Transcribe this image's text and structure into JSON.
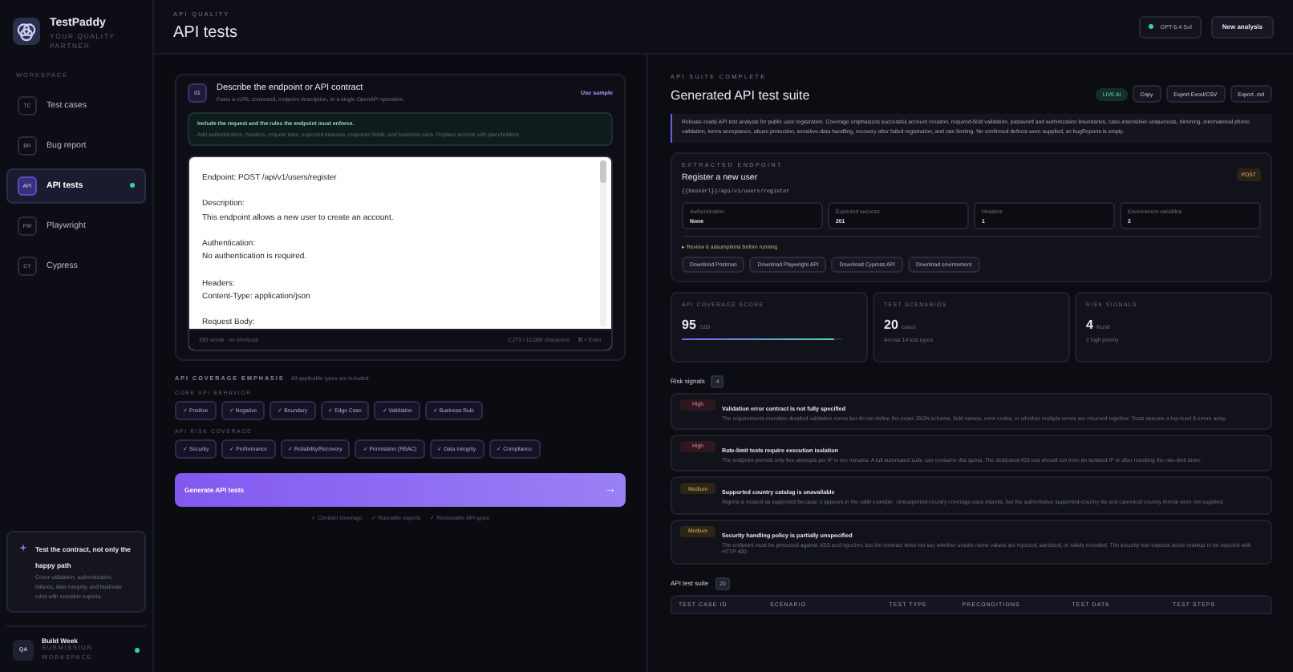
{
  "sidebar": {
    "brand": "TestPaddy",
    "tagline": "YOUR QUALITY PARTNER",
    "section": "WORKSPACE",
    "items": [
      {
        "badge": "TC",
        "label": "Test cases",
        "selected": false
      },
      {
        "badge": "BR",
        "label": "Bug report",
        "selected": false
      },
      {
        "badge": "API",
        "label": "API tests",
        "selected": true
      },
      {
        "badge": "PW",
        "label": "Playwright",
        "selected": false
      },
      {
        "badge": "CY",
        "label": "Cypress",
        "selected": false
      }
    ],
    "tip": {
      "title": "Test the contract, not only the happy path",
      "body": "Cover validation, authentication, failures, data integrity, and business rules with runnable exports."
    },
    "workspace": {
      "avatar": "QA",
      "name": "Build Week",
      "role": "SUBMISSION WORKSPACE",
      "online": true
    }
  },
  "header": {
    "eyebrow": "API QUALITY",
    "title": "API tests",
    "model": "GPT-5.4 Sol",
    "model_online": true,
    "button": "New analysis"
  },
  "input": {
    "step": "01",
    "heading": "Describe the endpoint or API contract",
    "subheading": "Paste a cURL command, endpoint description, or a single OpenAPI operation.",
    "sample_link": "Use sample",
    "hint_title": "Include the request and the rules the endpoint must enforce.",
    "hint_body": "Add authentication, headers, request data, expected statuses, response fields, and business rules. Replace secrets with placeholders.",
    "value": "Endpoint: POST /api/v1/users/register\n\nDescription:\nThis endpoint allows a new user to create an account.\n\nAuthentication:\nNo authentication is required.\n\nHeaders:\nContent-Type: application/json\n\nRequest Body:",
    "word_count": "330 words · no shortcuts",
    "char_count": "2,273 / 12,000 characters",
    "shortcut": "⌘ + Enter"
  },
  "coverage": {
    "title": "API COVERAGE EMPHASIS",
    "note": "All applicable types are included",
    "groups": [
      {
        "label": "CORE API BEHAVIOR",
        "chips": [
          {
            "label": "✓ Positive",
            "checked": true
          },
          {
            "label": "✓ Negative",
            "checked": true
          },
          {
            "label": "✓ Boundary",
            "checked": true
          },
          {
            "label": "✓ Edge Case",
            "checked": true
          },
          {
            "label": "✓ Validation",
            "checked": true
          },
          {
            "label": "✓ Business Rule",
            "checked": true
          }
        ]
      },
      {
        "label": "API RISK COVERAGE",
        "chips": [
          {
            "label": "✓ Security",
            "checked": true
          },
          {
            "label": "✓ Performance",
            "checked": true
          },
          {
            "label": "✓ Reliability/Recovery",
            "checked": true
          },
          {
            "label": "✓ Permission (RBAC)",
            "checked": true
          },
          {
            "label": "✓ Data Integrity",
            "checked": true
          },
          {
            "label": "✓ Compliance",
            "checked": true
          }
        ]
      }
    ]
  },
  "generate": {
    "label": "Generate API tests",
    "arrow": "→",
    "notes": [
      "✓ Contract coverage",
      "✓ Runnable exports",
      "✓ Reviewable API types"
    ]
  },
  "result": {
    "eyebrow": "API SUITE COMPLETE",
    "title": "Generated API test suite",
    "badge": "LIVE AI",
    "actions": [
      "Copy",
      "Export Excel/CSV",
      "Export .md"
    ],
    "summary": "Release-ready API test analysis for public user registration. Coverage emphasizes successful account creation, required-field validation, password and authorization boundaries, case-insensitive uniqueness, trimming, international phone validation, terms acceptance, abuse protection, sensitive-data handling, recovery after failed registration, and rate limiting. No confirmed defects were supplied, so bugReports is empty.",
    "endpoint": {
      "eyebrow": "EXTRACTED ENDPOINT",
      "name": "Register a new user",
      "path": "{{baseUrl}}/api/v1/users/register",
      "method": "POST",
      "facts": [
        {
          "label": "Authentication",
          "value": "None"
        },
        {
          "label": "Expected success",
          "value": "201"
        },
        {
          "label": "Headers",
          "value": "1"
        },
        {
          "label": "Environment variables",
          "value": "2"
        }
      ],
      "assumptions": "▸ Review 6 assumptions before running",
      "downloads": [
        "Download Postman",
        "Download Playwright API",
        "Download Cypress API",
        "Download environment"
      ]
    },
    "metrics": [
      {
        "label": "API COVERAGE SCORE",
        "value": "95",
        "unit": "/100",
        "level": 0.95
      },
      {
        "label": "TEST SCENARIOS",
        "value": "20",
        "unit": "cases",
        "note": "Across 14 test types"
      },
      {
        "label": "RISK SIGNALS",
        "value": "4",
        "unit": "found",
        "note": "2 high priority"
      }
    ],
    "risks_title": "Risk signals",
    "risks_count": "4",
    "risks": [
      {
        "severity": "High",
        "kind": "high",
        "title": "Validation error contract is not fully specified",
        "body": "The requirements mandate detailed validation errors but do not define the exact JSON schema, field names, error codes, or whether multiple errors are returned together. Tests assume a top-level $.errors array."
      },
      {
        "severity": "High",
        "kind": "high",
        "title": "Rate-limit tests require execution isolation",
        "body": "The endpoint permits only five attempts per IP in ten minutes. A full automated suite can consume this quota. The dedicated 429 test should run from an isolated IP or after resetting the rate-limit store."
      },
      {
        "severity": "Medium",
        "kind": "medium",
        "title": "Supported country catalog is unavailable",
        "body": "Nigeria is treated as supported because it appears in the valid example. Unsupported-country coverage uses Atlantis, but the authoritative supported-country list and canonical country format were not supplied."
      },
      {
        "severity": "Medium",
        "kind": "medium",
        "title": "Security handling policy is partially unspecified",
        "body": "The endpoint must be protected against XSS and injection, but the contract does not say whether unsafe name values are rejected, sanitized, or safely encoded. The security test expects active markup to be rejected with HTTP 400."
      }
    ],
    "suite_title": "API test suite",
    "suite_count": "20",
    "columns": [
      "TEST CASE ID",
      "SCENARIO",
      "TEST TYPE",
      "PRECONDITIONS",
      "TEST DATA",
      "TEST STEPS"
    ]
  }
}
